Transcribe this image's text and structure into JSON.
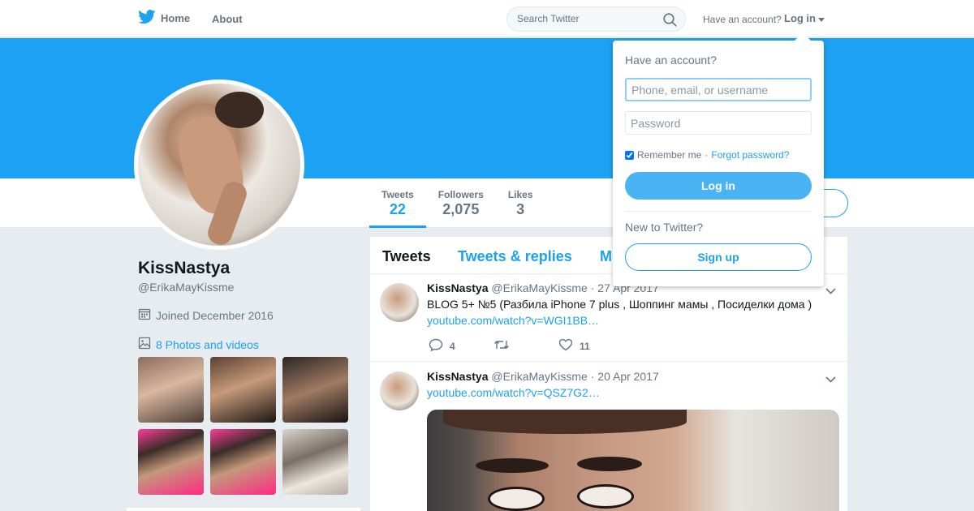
{
  "nav": {
    "home_label": "Home",
    "about_label": "About",
    "search_placeholder": "Search Twitter",
    "have_account": "Have an account?",
    "login_label": "Log in"
  },
  "profile": {
    "name": "KissNastya",
    "handle": "@ErikaMayKissme",
    "joined": "Joined December 2016",
    "photos_link": "8 Photos and videos"
  },
  "stats": [
    {
      "label": "Tweets",
      "value": "22"
    },
    {
      "label": "Followers",
      "value": "2,075"
    },
    {
      "label": "Likes",
      "value": "3"
    }
  ],
  "timeline": {
    "tabs": [
      "Tweets",
      "Tweets & replies",
      "M"
    ],
    "tweets": [
      {
        "name": "KissNastya",
        "meta": "@ErikaMayKissme · 27 Apr 2017",
        "text": "BLOG 5+ №5 (Разбила iPhone 7 plus ,  Шоппинг мамы , Посиделки дома )",
        "link": "youtube.com/watch?v=WGI1BB…",
        "replies": "4",
        "likes": "11"
      },
      {
        "name": "KissNastya",
        "meta": "@ErikaMayKissme · 20 Apr 2017",
        "link": "youtube.com/watch?v=QSZ7G2…"
      }
    ]
  },
  "login_dropdown": {
    "title": "Have an account?",
    "username_placeholder": "Phone, email, or username",
    "password_placeholder": "Password",
    "remember_label": "Remember me",
    "separator": "·",
    "forgot_label": "Forgot password?",
    "login_button": "Log in",
    "new_label": "New to Twitter?",
    "signup_button": "Sign up"
  },
  "colors": {
    "brand": "#1da1f2",
    "background": "#e6ecf0"
  }
}
